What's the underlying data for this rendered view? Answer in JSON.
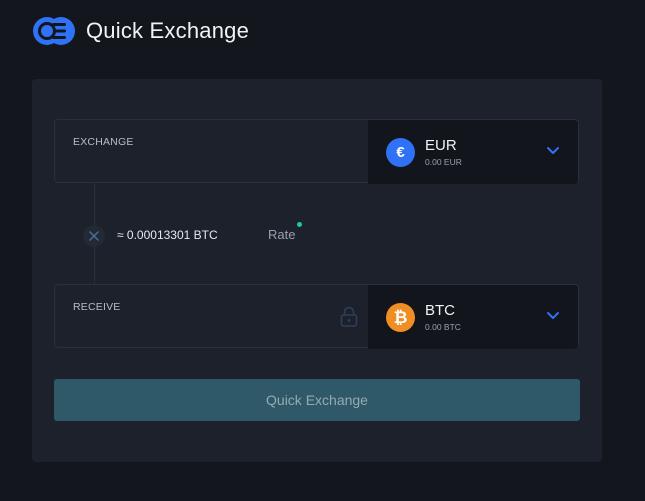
{
  "header": {
    "title": "Quick Exchange",
    "logo_icon": "logo-icon"
  },
  "exchange": {
    "label": "EXCHANGE",
    "currency": {
      "code": "EUR",
      "symbol": "€",
      "balance": "0.00 EUR",
      "color": "#2f72f5"
    }
  },
  "rate": {
    "value": "≈ 0.00013301 BTC",
    "label": "Rate",
    "status_color": "#1fc7a0"
  },
  "receive": {
    "label": "RECEIVE",
    "currency": {
      "code": "BTC",
      "symbol": "₿",
      "balance": "0.00 BTC",
      "color": "#f08e23"
    }
  },
  "submit": {
    "label": "Quick Exchange",
    "color": "#2f5968"
  }
}
